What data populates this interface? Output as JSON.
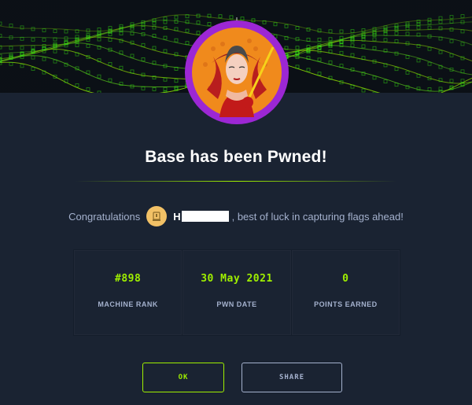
{
  "modal": {
    "title": "Base has been Pwned!",
    "congrats_prefix": "Congratulations",
    "username_initial": "H",
    "congrats_suffix": ", best of luck in capturing flags ahead!"
  },
  "stats": [
    {
      "value": "#898",
      "label": "MACHINE RANK"
    },
    {
      "value": "30 May 2021",
      "label": "PWN DATE"
    },
    {
      "value": "0",
      "label": "POINTS EARNED"
    }
  ],
  "buttons": {
    "ok_label": "OK",
    "share_label": "SHARE"
  },
  "colors": {
    "accent": "#9fef00",
    "background": "#1a2332",
    "muted_text": "#a4b1cd",
    "avatar_ring": "#9c27d4"
  }
}
